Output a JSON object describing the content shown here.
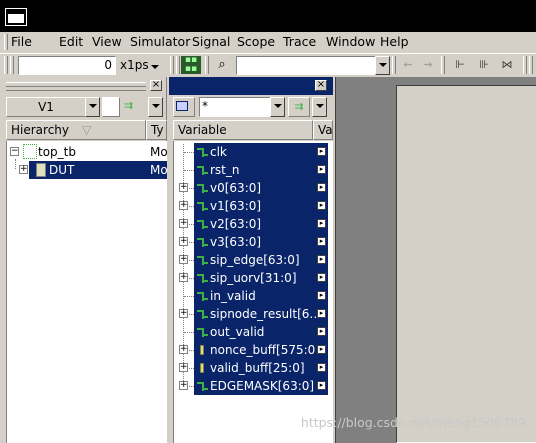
{
  "menubar": {
    "items": [
      "File",
      "Edit",
      "View",
      "Simulator",
      "Signal",
      "Scope",
      "Trace",
      "Window",
      "Help"
    ]
  },
  "toolbar": {
    "time_value": "0",
    "time_unit": "x1ps",
    "search_value": ""
  },
  "hierarchy_panel": {
    "scope_select": "V1",
    "column_hierarchy": "Hierarchy",
    "column_type": "Ty",
    "rows": [
      {
        "name": "top_tb",
        "type": "Mo"
      },
      {
        "name": "DUT",
        "type": "Mo"
      }
    ]
  },
  "variable_panel": {
    "filter_value": "*",
    "column_variable": "Variable",
    "column_extra": "Va",
    "rows": [
      {
        "name": "clk",
        "kind": "signal",
        "expandable": false
      },
      {
        "name": "rst_n",
        "kind": "signal",
        "expandable": false
      },
      {
        "name": "v0[63:0]",
        "kind": "signal",
        "expandable": true
      },
      {
        "name": "v1[63:0]",
        "kind": "signal",
        "expandable": true
      },
      {
        "name": "v2[63:0]",
        "kind": "signal",
        "expandable": true
      },
      {
        "name": "v3[63:0]",
        "kind": "signal",
        "expandable": true
      },
      {
        "name": "sip_edge[63:0]",
        "kind": "signal",
        "expandable": true
      },
      {
        "name": "sip_uorv[31:0]",
        "kind": "signal",
        "expandable": true
      },
      {
        "name": "in_valid",
        "kind": "signal",
        "expandable": false
      },
      {
        "name": "sipnode_result[6…",
        "kind": "signal",
        "expandable": true
      },
      {
        "name": "out_valid",
        "kind": "signal",
        "expandable": false
      },
      {
        "name": "nonce_buff[575:0]",
        "kind": "bus",
        "expandable": true
      },
      {
        "name": "valid_buff[25:0]",
        "kind": "bus",
        "expandable": true
      },
      {
        "name": "EDGEMASK[63:0]",
        "kind": "signal",
        "expandable": true
      }
    ]
  },
  "watermark": "https://blog.csdn.net/meng1506789",
  "colors": {
    "selection": "#0a246a",
    "signal_icon": "#3cb043",
    "chrome": "#d4d0c8"
  }
}
